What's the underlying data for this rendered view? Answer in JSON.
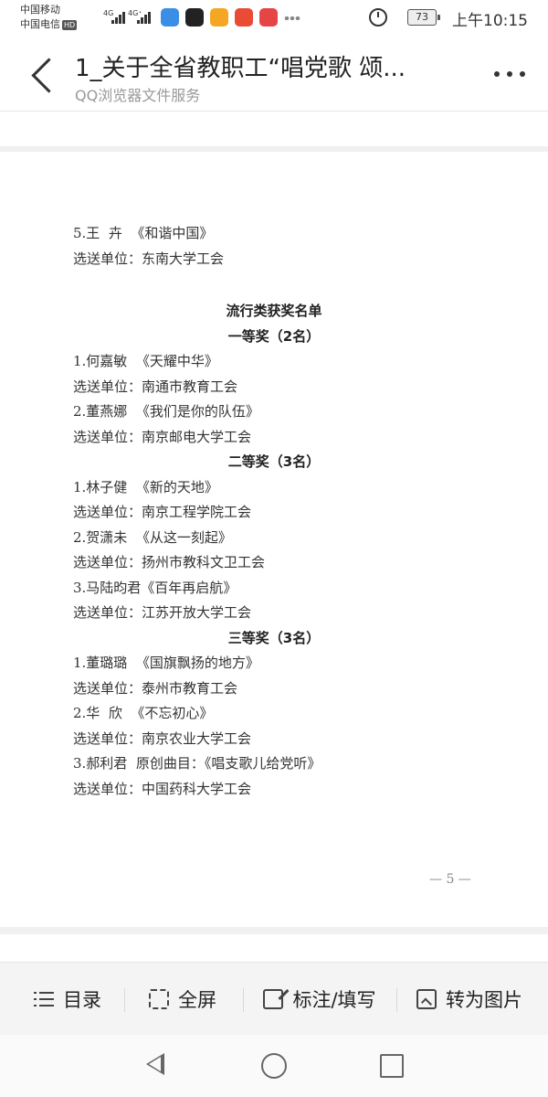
{
  "status_bar": {
    "carrier1": "中国移动",
    "carrier2": "中国电信",
    "hd": "HD",
    "signal1": "4G",
    "signal2": "4G⁺",
    "battery": "73",
    "time": "上午10:15",
    "app_icons": [
      "browser-icon",
      "qq-icon",
      "shopping-icon",
      "alipay-icon",
      "message-icon",
      "more-icon"
    ],
    "icon_colors": [
      "#3a8ee6",
      "#222222",
      "#f5a623",
      "#e94b35",
      "#e64545",
      "#888888"
    ]
  },
  "header": {
    "title": "1_关于全省教职工“唱党歌 颂...",
    "subtitle": "QQ浏览器文件服务"
  },
  "document": {
    "lines": [
      {
        "kind": "text",
        "text": "5.王  卉  《和谐中国》"
      },
      {
        "kind": "text",
        "text": "选送单位：东南大学工会"
      },
      {
        "kind": "heading",
        "text": "流行类获奖名单"
      },
      {
        "kind": "heading",
        "text": "一等奖（2名）"
      },
      {
        "kind": "text",
        "text": "1.何嘉敏  《天耀中华》"
      },
      {
        "kind": "text",
        "text": "选送单位：南通市教育工会"
      },
      {
        "kind": "text",
        "text": "2.董燕娜  《我们是你的队伍》"
      },
      {
        "kind": "text",
        "text": "选送单位：南京邮电大学工会"
      },
      {
        "kind": "heading",
        "text": "二等奖（3名）"
      },
      {
        "kind": "text",
        "text": "1.林子健  《新的天地》"
      },
      {
        "kind": "text",
        "text": "选送单位：南京工程学院工会"
      },
      {
        "kind": "text",
        "text": "2.贺潇未  《从这一刻起》"
      },
      {
        "kind": "text",
        "text": "选送单位：扬州市教科文卫工会"
      },
      {
        "kind": "text",
        "text": "3.马陆昀君《百年再启航》"
      },
      {
        "kind": "text",
        "text": "选送单位：江苏开放大学工会"
      },
      {
        "kind": "heading",
        "text": "三等奖（3名）"
      },
      {
        "kind": "text",
        "text": "1.董璐璐  《国旗飘扬的地方》"
      },
      {
        "kind": "text",
        "text": "选送单位：泰州市教育工会"
      },
      {
        "kind": "text",
        "text": "2.华  欣  《不忘初心》"
      },
      {
        "kind": "text",
        "text": "选送单位：南京农业大学工会"
      },
      {
        "kind": "text",
        "text": "3.郝利君  原创曲目：《唱支歌儿给党听》"
      },
      {
        "kind": "text",
        "text": "选送单位：中国药科大学工会"
      }
    ],
    "page_number": "— 5 —"
  },
  "toolbar": {
    "items": [
      {
        "label": "目录",
        "icon": "list-icon"
      },
      {
        "label": "全屏",
        "icon": "fullscreen-icon"
      },
      {
        "label": "标注/填写",
        "icon": "edit-icon"
      },
      {
        "label": "转为图片",
        "icon": "image-convert-icon"
      }
    ]
  },
  "nav_bar": {
    "items": [
      "back-triangle-icon",
      "home-circle-icon",
      "recent-square-icon"
    ]
  }
}
